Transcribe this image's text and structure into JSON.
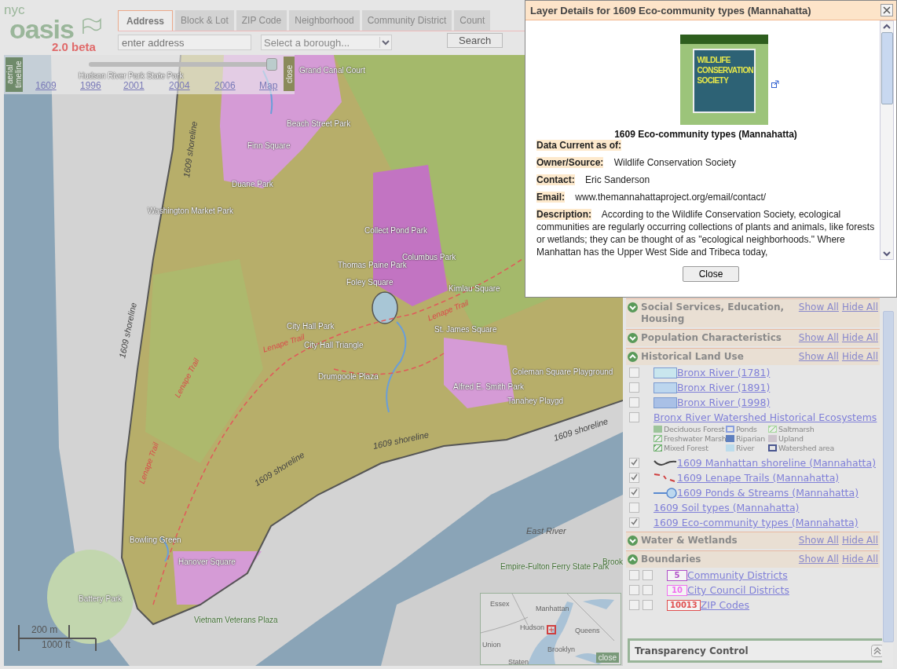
{
  "logo": {
    "prefix": "nyc",
    "name": "oasis",
    "version": "2.0 beta"
  },
  "search_tabs": [
    {
      "label": "Address",
      "selected": true
    },
    {
      "label": "Block & Lot",
      "selected": false
    },
    {
      "label": "ZIP Code",
      "selected": false
    },
    {
      "label": "Neighborhood",
      "selected": false
    },
    {
      "label": "Community District",
      "selected": false
    },
    {
      "label": "Count",
      "selected": false
    }
  ],
  "search": {
    "placeholder": "enter address",
    "borough_placeholder": "Select a borough...",
    "button": "Search"
  },
  "timeline": {
    "title": "aerial timeline",
    "stops": [
      "1609",
      "1996",
      "2001",
      "2004",
      "2006",
      "Map"
    ],
    "level": 1,
    "close": "close"
  },
  "map": {
    "labels": [
      {
        "text": "Hudson River Park State Park",
        "kind": "place"
      },
      {
        "text": "Grand Canal Court",
        "kind": "place"
      },
      {
        "text": "Beach Street Park",
        "kind": "place"
      },
      {
        "text": "Finn Square",
        "kind": "place"
      },
      {
        "text": "Duane Park",
        "kind": "place"
      },
      {
        "text": "Washington Market Park",
        "kind": "place"
      },
      {
        "text": "Collect Pond Park",
        "kind": "place"
      },
      {
        "text": "Columbus Park",
        "kind": "place"
      },
      {
        "text": "Thomas Paine Park",
        "kind": "place"
      },
      {
        "text": "Foley Square",
        "kind": "place"
      },
      {
        "text": "Kimlau Square",
        "kind": "place"
      },
      {
        "text": "City Hall Park",
        "kind": "place"
      },
      {
        "text": "St. James Square",
        "kind": "place"
      },
      {
        "text": "City Hall Triangle",
        "kind": "place"
      },
      {
        "text": "Drumgoole Plaza",
        "kind": "place"
      },
      {
        "text": "Coleman Square Playground",
        "kind": "place"
      },
      {
        "text": "Alfred E. Smith Park",
        "kind": "place"
      },
      {
        "text": "Tanahey Playgd",
        "kind": "place"
      },
      {
        "text": "East River",
        "kind": "water"
      },
      {
        "text": "Bowling Green",
        "kind": "place"
      },
      {
        "text": "Hanover Square",
        "kind": "place"
      },
      {
        "text": "Battery Park",
        "kind": "place"
      },
      {
        "text": "Vietnam Veterans Plaza",
        "kind": "park"
      },
      {
        "text": "Empire-Fulton Ferry State Park",
        "kind": "park"
      },
      {
        "text": "Brook",
        "kind": "park"
      },
      {
        "text": "1609 shoreline",
        "kind": "shoreline"
      },
      {
        "text": "1609 shoreline",
        "kind": "shoreline"
      },
      {
        "text": "1609 shoreline",
        "kind": "shoreline"
      },
      {
        "text": "1609 shoreline",
        "kind": "shoreline"
      },
      {
        "text": "1609 shoreline",
        "kind": "shoreline"
      },
      {
        "text": "Lenape Trail",
        "kind": "trail"
      },
      {
        "text": "Lenape Trail",
        "kind": "trail"
      },
      {
        "text": "Lenape Trail",
        "kind": "trail"
      },
      {
        "text": "Lenape Trail",
        "kind": "trail"
      }
    ],
    "scale": {
      "metric": "200 m",
      "imperial": "1000 ft"
    },
    "overview": {
      "labels": [
        "Essex",
        "Manhattan",
        "Hudson",
        "Queens",
        "Union",
        "Brooklyn",
        "Staten"
      ],
      "close": "close"
    }
  },
  "panel": {
    "groups": [
      {
        "title": "Social Services, Education, Housing",
        "expanded": false,
        "show": "Show All",
        "hide": "Hide All"
      },
      {
        "title": "Population Characteristics",
        "expanded": false,
        "show": "Show All",
        "hide": "Hide All"
      },
      {
        "title": "Historical Land Use",
        "expanded": true,
        "show": "Show All",
        "hide": "Hide All",
        "layers": [
          {
            "kind": "swatch",
            "color": "#c9e6ee",
            "label": "Bronx River (1781)",
            "checked": false
          },
          {
            "kind": "swatch",
            "color": "#bcd6ee",
            "label": "Bronx River (1891)",
            "checked": false
          },
          {
            "kind": "swatch",
            "color": "#a9c0e6",
            "label": "Bronx River (1998)",
            "checked": false
          },
          {
            "kind": "plain",
            "label": "Bronx River Watershed Historical Ecosystems",
            "checked": false,
            "legend": [
              {
                "label": "Deciduous Forest",
                "kind": "fill",
                "color": "#9cc49a"
              },
              {
                "label": "Ponds",
                "kind": "outline",
                "color": "#8aa0e0"
              },
              {
                "label": "Saltmarsh",
                "kind": "hatch",
                "color": "#a8d8a0"
              },
              {
                "label": "Freshwater Marsh",
                "kind": "hatch",
                "color": "#88c088"
              },
              {
                "label": "Riparian",
                "kind": "fill",
                "color": "#5e7fbf"
              },
              {
                "label": "Upland",
                "kind": "fill",
                "color": "#cdc4cd"
              },
              {
                "label": "Mixed Forest",
                "kind": "hatch",
                "color": "#70b070"
              },
              {
                "label": "River",
                "kind": "fill",
                "color": "#bcdcec"
              },
              {
                "label": "Watershed area",
                "kind": "outline",
                "color": "#4a5690"
              }
            ]
          },
          {
            "kind": "shoreline",
            "label": "1609 Manhattan shoreline (Mannahatta)",
            "checked": true
          },
          {
            "kind": "trail",
            "label": "1609 Lenape Trails (Mannahatta)",
            "checked": true
          },
          {
            "kind": "stream",
            "label": "1609 Ponds & Streams (Mannahatta)",
            "checked": true
          },
          {
            "kind": "plain",
            "label": "1609 Soil types (Mannahatta)",
            "checked": false
          },
          {
            "kind": "plain",
            "label": "1609 Eco-community types (Mannahatta)",
            "checked": true
          }
        ]
      },
      {
        "title": "Water & Wetlands",
        "expanded": false,
        "show": "Show All",
        "hide": "Hide All"
      },
      {
        "title": "Boundaries",
        "expanded": true,
        "show": "Show All",
        "hide": "Hide All",
        "layers": [
          {
            "kind": "badge",
            "badge": "5",
            "color": "#b050c8",
            "label": "Community Districts",
            "checked": false,
            "second_checked": false
          },
          {
            "kind": "badge",
            "badge": "10",
            "color": "#f070f0",
            "label": "City Council Districts",
            "checked": false,
            "second_checked": false
          },
          {
            "kind": "badge",
            "badge": "10013",
            "color": "#e05050",
            "label": "ZIP Codes",
            "checked": false,
            "second_checked": false
          }
        ]
      }
    ],
    "transparency": {
      "title": "Transparency Control"
    }
  },
  "popup": {
    "title": "Layer Details for 1609 Eco-community types (Mannahatta)",
    "logo_lines": [
      "WILDLIFE",
      "CONSERVATION",
      "SOCIETY"
    ],
    "caption": "1609 Eco-community types (Mannahatta)",
    "fields": [
      {
        "label": "Data Current as of:"
      },
      {
        "label": "Owner/Source:",
        "value": "Wildlife Conservation Society"
      },
      {
        "label": "Contact:",
        "value": "Eric Sanderson"
      },
      {
        "label": "Email:",
        "value": "www.themannahattaproject.org/email/contact/"
      },
      {
        "label": "Description:",
        "value": "According to the Wildlife Conservation Society, ecological communities are regularly occurring collections of plants and animals, like forests or wetlands; they can be thought of as \"ecological neighborhoods.\" Where Manhattan has the Upper West Side and Tribeca today,"
      }
    ],
    "close": "Close"
  }
}
